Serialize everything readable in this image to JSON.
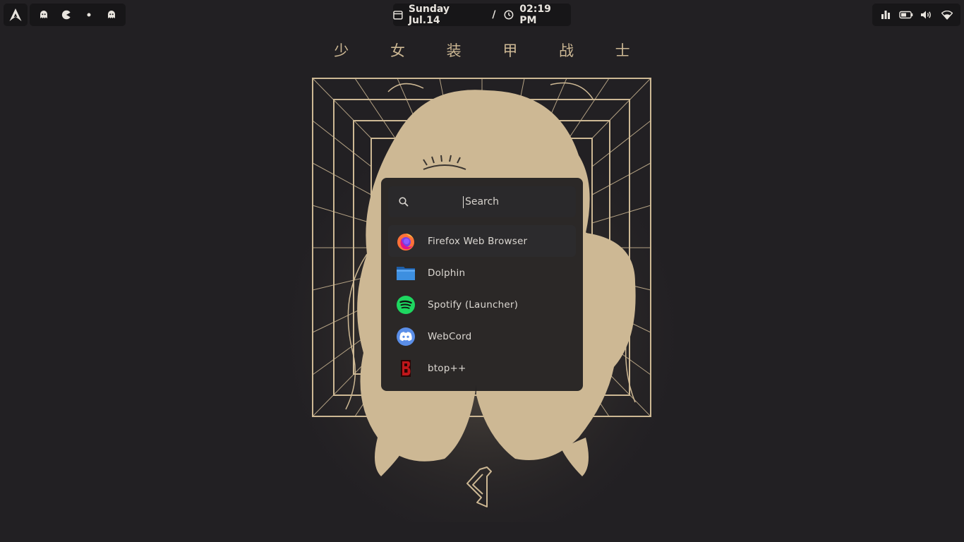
{
  "topbar": {
    "launcher_icon": "arch-linux-icon",
    "workspaces": [
      {
        "icon": "ghost-icon"
      },
      {
        "icon": "pacman-icon"
      },
      {
        "icon": "dot-icon"
      },
      {
        "icon": "ghost-icon"
      }
    ],
    "clock": {
      "date": "Sunday Jul.14",
      "separator": "/",
      "time": "02:19 PM"
    },
    "tray": [
      {
        "icon": "stats-bars-icon"
      },
      {
        "icon": "battery-icon"
      },
      {
        "icon": "volume-icon"
      },
      {
        "icon": "wifi-icon"
      }
    ]
  },
  "wallpaper": {
    "title": "少 女 装 甲 战 士"
  },
  "launcher": {
    "search_placeholder": "Search",
    "apps": [
      {
        "label": "Firefox Web Browser",
        "icon": "firefox-icon",
        "selected": true
      },
      {
        "label": "Dolphin",
        "icon": "folder-icon",
        "selected": false
      },
      {
        "label": "Spotify (Launcher)",
        "icon": "spotify-icon",
        "selected": false
      },
      {
        "label": "WebCord",
        "icon": "discord-icon",
        "selected": false
      },
      {
        "label": "btop++",
        "icon": "btop-icon",
        "selected": false
      }
    ]
  },
  "colors": {
    "background": "#222023",
    "accent": "#cdb894",
    "panel": "#171618"
  }
}
